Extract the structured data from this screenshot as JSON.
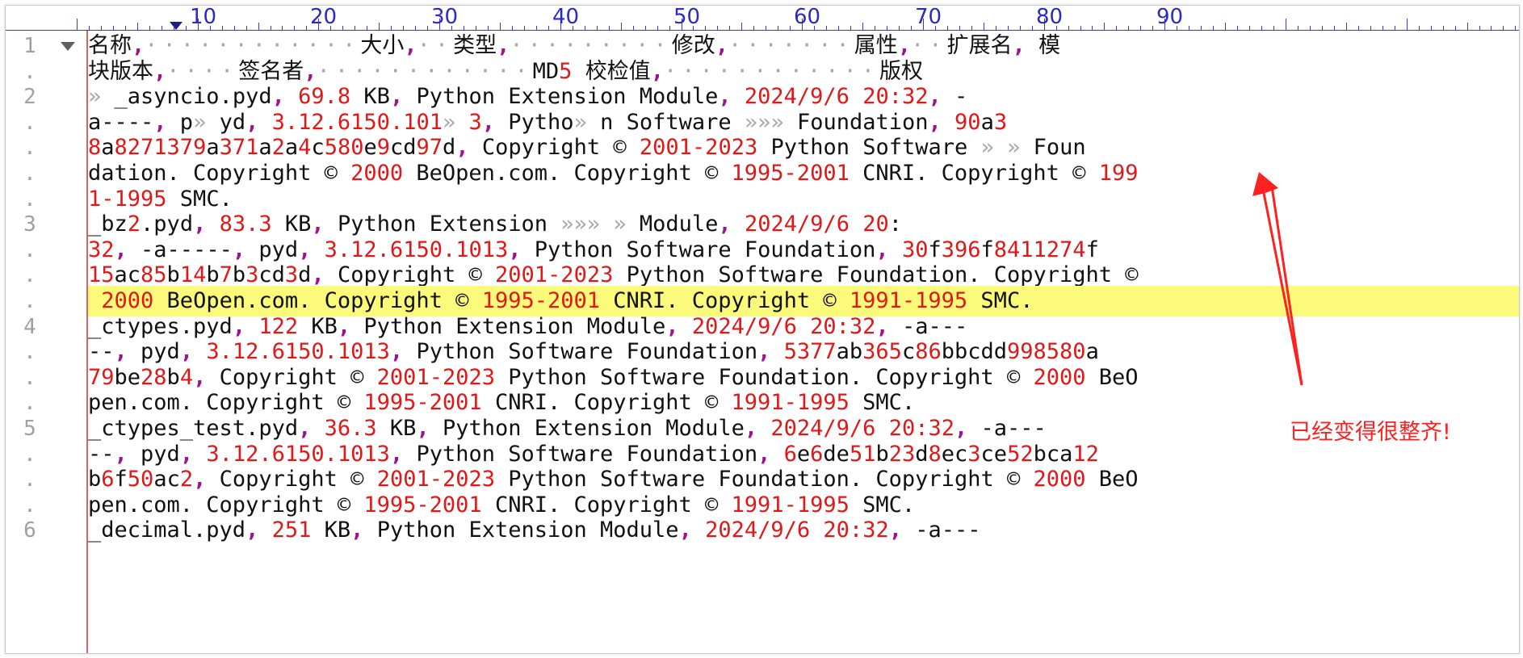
{
  "ruler": {
    "labels": [
      "10",
      "20",
      "30",
      "40",
      "50",
      "60",
      "70",
      "80",
      "90"
    ]
  },
  "gutter": {
    "line_numbers": [
      "1",
      ".",
      "2",
      ".",
      ".",
      ".",
      ".",
      "3",
      ".",
      ".",
      ".",
      "4",
      ".",
      ".",
      ".",
      "5",
      ".",
      ".",
      ".",
      "6"
    ]
  },
  "editor": {
    "highlight_color": "#fbfa7a",
    "number_color": "#e11818",
    "comma_color": "#a01090",
    "lines": [
      "名称,　　　　　　　　　　　　大小,　　类型,　　　　　　　　　修改,　　　　　　　属性,　　扩展名, 模",
      "块版本,　　　　签名者,　　　　　　　　　　　　MD5 校检值,　　　　　　　　　　　　版权",
      "» _asyncio.pyd, 69.8 KB, Python Extension Module, 2024/9/6 20:32, -",
      "a----, p» yd, 3.12.6150.101» 3, Pytho» n Software »»» Foundation, 90a3",
      "8a8271379a371a2a4c580e9cd97d, Copyright © 2001-2023 Python Software » » Foun",
      "dation. Copyright © 2000 BeOpen.com. Copyright © 1995-2001 CNRI. Copyright © 199",
      "1-1995 SMC.",
      "_bz2.pyd, 83.3 KB, Python Extension »»» » Module, 2024/9/6 20:",
      "32, -a-----, pyd, 3.12.6150.1013, Python Software Foundation, 30f396f8411274f",
      "15ac85b14b7b3cd3d, Copyright © 2001-2023 Python Software Foundation. Copyright ©",
      " 2000 BeOpen.com. Copyright © 1995-2001 CNRI. Copyright © 1991-1995 SMC.",
      "_ctypes.pyd, 122 KB, Python Extension Module, 2024/9/6 20:32, -a---",
      "--, pyd, 3.12.6150.1013, Python Software Foundation, 5377ab365c86bbcdd998580a",
      "79be28b4, Copyright © 2001-2023 Python Software Foundation. Copyright © 2000 BeO",
      "pen.com. Copyright © 1995-2001 CNRI. Copyright © 1991-1995 SMC.",
      "_ctypes_test.pyd, 36.3 KB, Python Extension Module, 2024/9/6 20:32, -a---",
      "--, pyd, 3.12.6150.1013, Python Software Foundation, 6e6de51b23d8ec3ce52bca12",
      "b6f50ac2, Copyright © 2001-2023 Python Software Foundation. Copyright © 2000 BeO",
      "pen.com. Copyright © 1995-2001 CNRI. Copyright © 1991-1995 SMC.",
      "_decimal.pyd, 251 KB, Python Extension Module, 2024/9/6 20:32, -a---"
    ]
  },
  "annotation": {
    "text": "已经变得很整齐!",
    "color": "#ff2020"
  }
}
